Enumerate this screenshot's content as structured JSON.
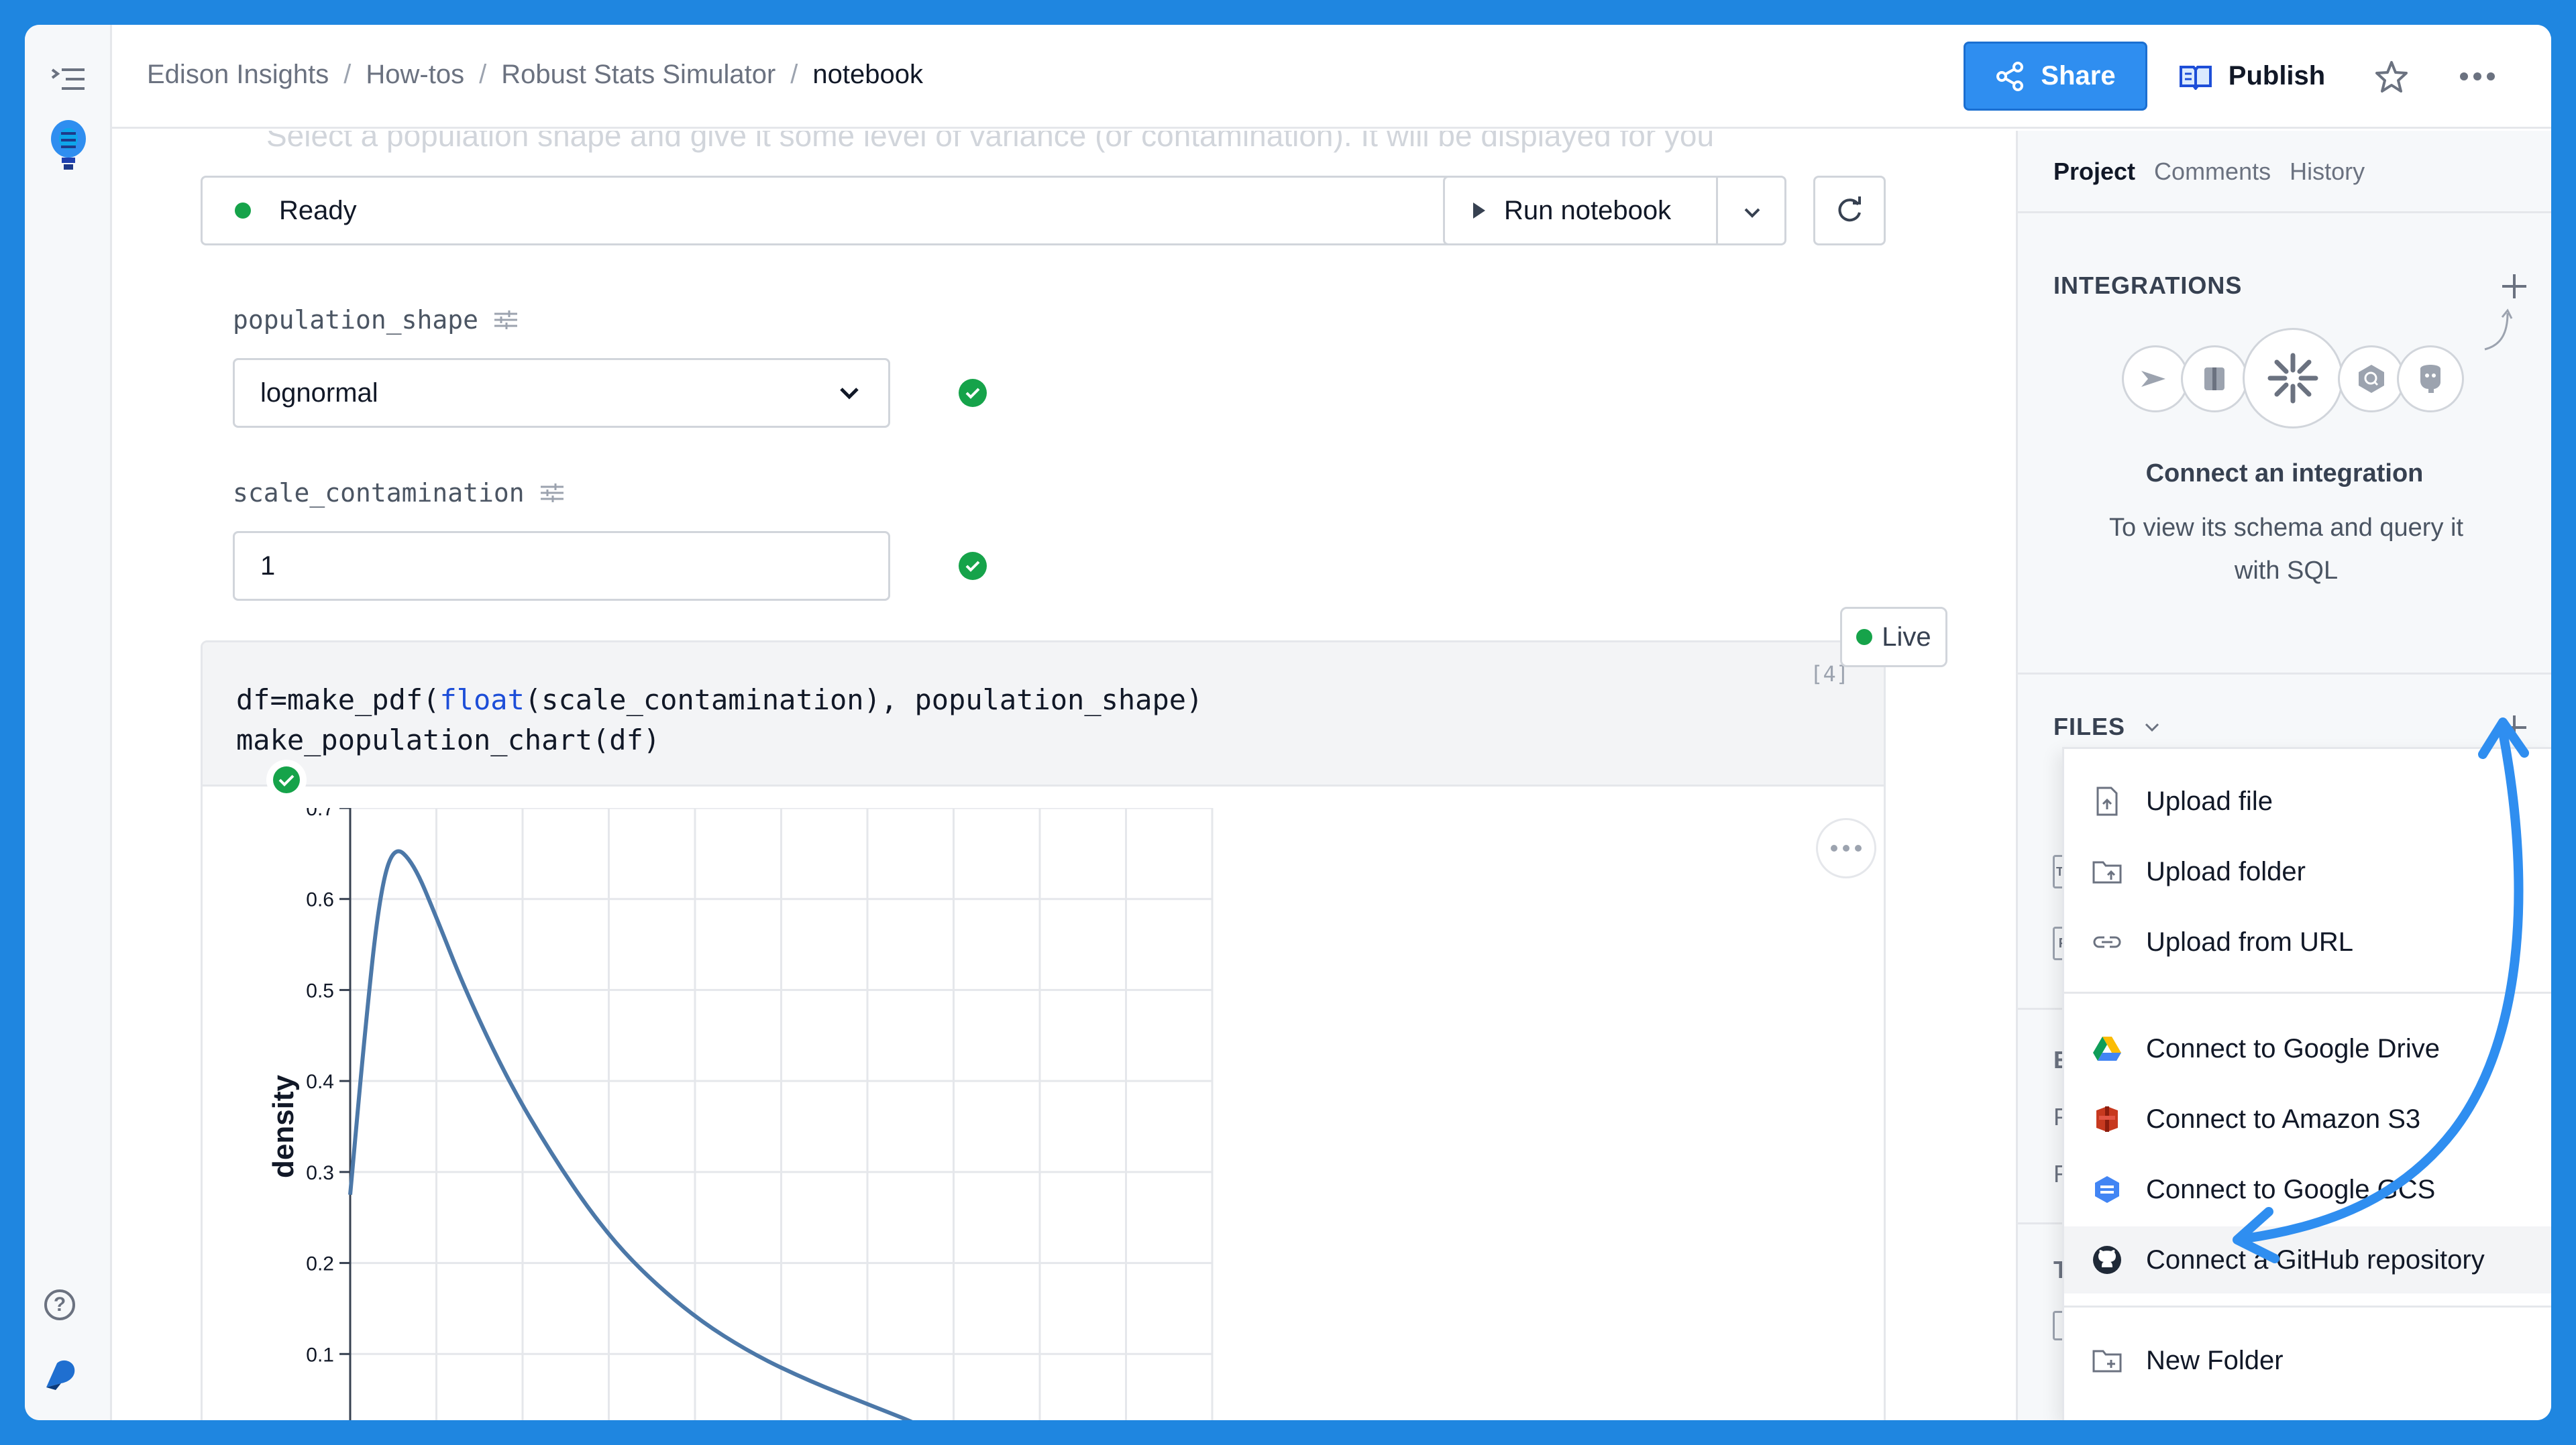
{
  "breadcrumb": [
    "Edison Insights",
    "How-tos",
    "Robust Stats Simulator",
    "notebook"
  ],
  "header": {
    "share_label": "Share",
    "publish_label": "Publish"
  },
  "notebook": {
    "faded_text": "Select a population shape and give it some level of variance (or contamination). It will be displayed for you",
    "status_text": "Ready",
    "run_label": "Run notebook",
    "params": [
      {
        "name": "population_shape",
        "value": "lognormal"
      },
      {
        "name": "scale_contamination",
        "value": "1"
      }
    ],
    "live_label": "Live",
    "exec_count": "[4]",
    "code": {
      "line1_a": "df=make_pdf(",
      "line1_kw": "float",
      "line1_b": "(scale_contamination), population_shape)",
      "line2": "make_population_chart(df)"
    }
  },
  "chart_data": {
    "type": "line",
    "ylabel": "density",
    "xlabel": "",
    "ylim": [
      0,
      0.7
    ],
    "yticks": [
      "0.1",
      "0.2",
      "0.3",
      "0.4",
      "0.5",
      "0.6",
      "0.7"
    ],
    "x_grid_count": 11,
    "series": [
      {
        "x": [
          0.0,
          0.05,
          0.1,
          0.15,
          0.22,
          0.3,
          0.4,
          0.55,
          0.7,
          0.85,
          1.0,
          1.2,
          1.4,
          1.6,
          1.8,
          2.0,
          2.1
        ],
        "y": [
          0.275,
          0.45,
          0.6,
          0.66,
          0.64,
          0.58,
          0.5,
          0.4,
          0.32,
          0.25,
          0.195,
          0.14,
          0.1,
          0.07,
          0.045,
          0.02,
          0.0
        ]
      }
    ],
    "color": "#4c78a8"
  },
  "panel": {
    "tabs": [
      "Project",
      "Comments",
      "History"
    ],
    "integrations_title": "INTEGRATIONS",
    "connect_title": "Connect an integration",
    "connect_desc": "To view its schema and query it with SQL",
    "files_title": "FILES",
    "ghost_labels": [
      "EN",
      "Py",
      "RA",
      "TE"
    ]
  },
  "menu": {
    "items": [
      {
        "label": "Upload file",
        "icon": "file-upload-icon"
      },
      {
        "label": "Upload folder",
        "icon": "folder-upload-icon"
      },
      {
        "label": "Upload from URL",
        "icon": "link-icon"
      },
      {
        "label": "Connect to Google Drive",
        "icon": "google-drive-icon"
      },
      {
        "label": "Connect to Amazon S3",
        "icon": "amazon-s3-icon"
      },
      {
        "label": "Connect to Google GCS",
        "icon": "google-gcs-icon"
      },
      {
        "label": "Connect a GitHub repository",
        "icon": "github-icon"
      },
      {
        "label": "New Folder",
        "icon": "new-folder-icon"
      }
    ]
  },
  "colors": {
    "accent": "#2f8ef0",
    "frame": "#1f86e0",
    "success": "#16a34a",
    "annotation_arrow": "#2f8ef0"
  }
}
